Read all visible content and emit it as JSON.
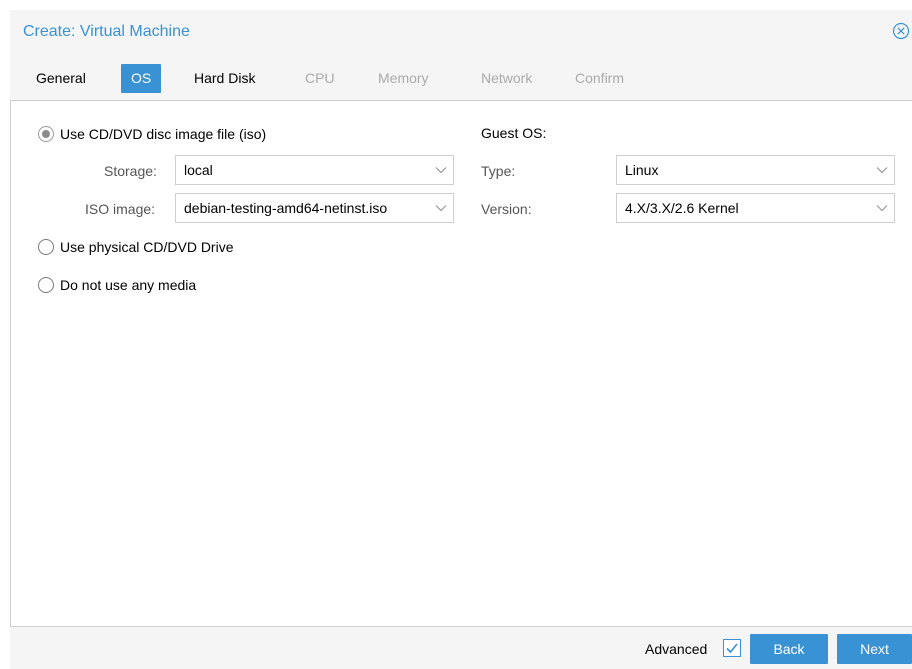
{
  "window": {
    "title": "Create: Virtual Machine",
    "close_icon": "close-circle-icon"
  },
  "tabs": [
    {
      "label": "General",
      "state": "enabled"
    },
    {
      "label": "OS",
      "state": "active"
    },
    {
      "label": "Hard Disk",
      "state": "enabled"
    },
    {
      "label": "CPU",
      "state": "disabled"
    },
    {
      "label": "Memory",
      "state": "disabled"
    },
    {
      "label": "Network",
      "state": "disabled"
    },
    {
      "label": "Confirm",
      "state": "disabled"
    }
  ],
  "media": {
    "iso_option": "Use CD/DVD disc image file (iso)",
    "iso_selected": true,
    "storage_label": "Storage:",
    "storage_value": "local",
    "iso_image_label": "ISO image:",
    "iso_image_value": "debian-testing-amd64-netinst.iso",
    "physical_option": "Use physical CD/DVD Drive",
    "none_option": "Do not use any media"
  },
  "guest_os": {
    "heading": "Guest OS:",
    "type_label": "Type:",
    "type_value": "Linux",
    "version_label": "Version:",
    "version_value": "4.X/3.X/2.6 Kernel"
  },
  "footer": {
    "advanced_label": "Advanced",
    "advanced_checked": true,
    "back_label": "Back",
    "next_label": "Next"
  },
  "colors": {
    "accent": "#3892d4",
    "header_bg": "#f5f5f5",
    "disabled_text": "#aaaaaa"
  }
}
